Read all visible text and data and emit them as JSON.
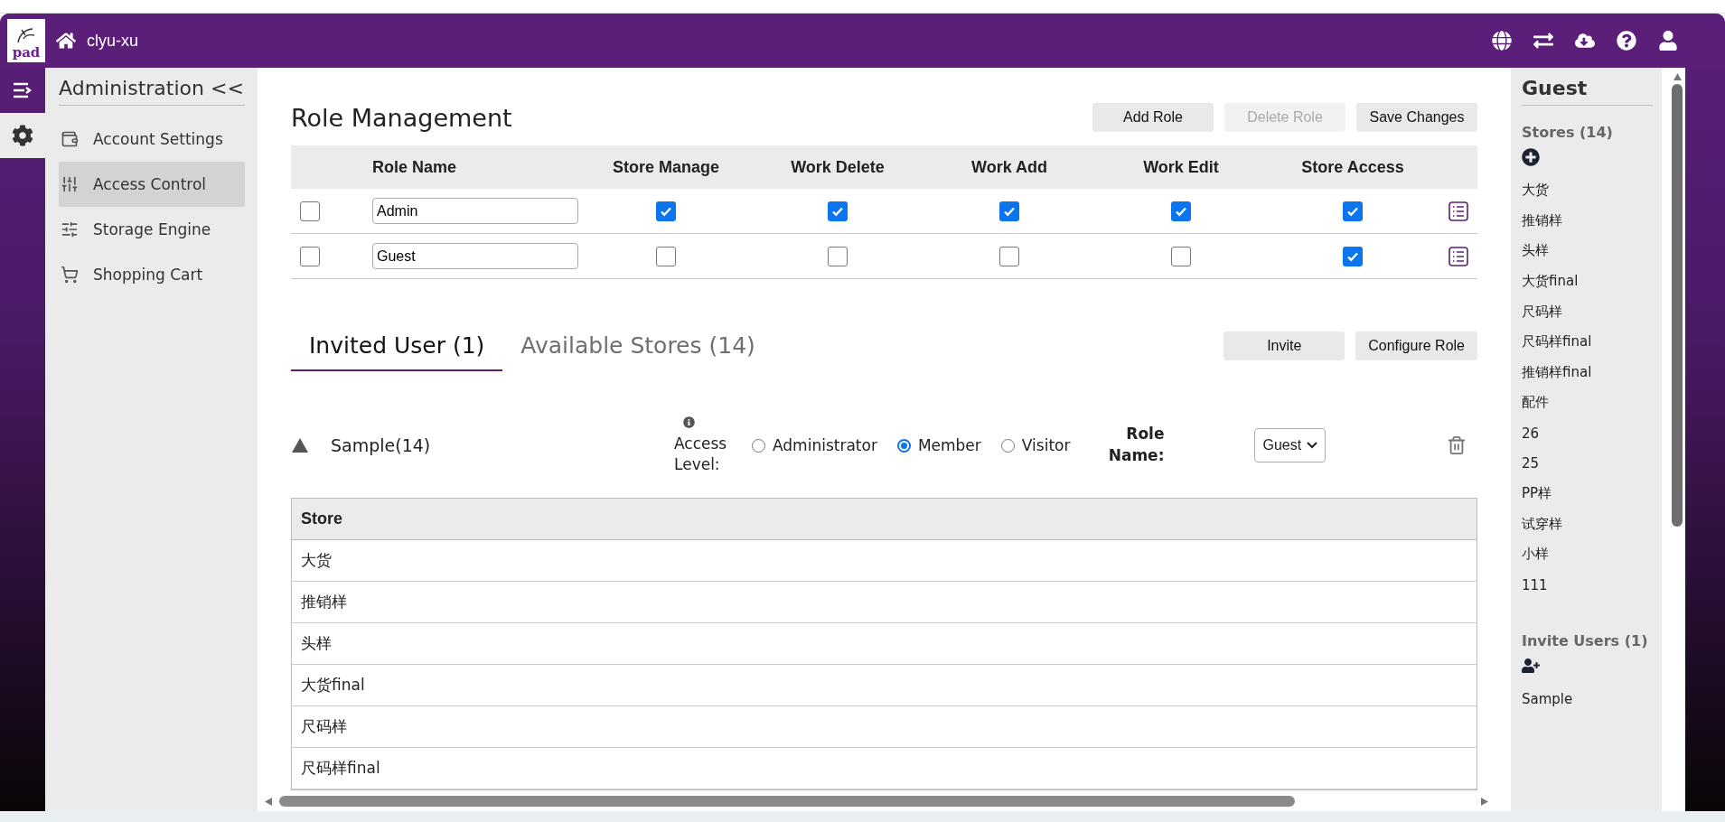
{
  "header": {
    "logo_text": "pad",
    "user": "clyu-xu",
    "actions": [
      {
        "kind": "globe"
      },
      {
        "kind": "switch"
      },
      {
        "kind": "cloud"
      },
      {
        "kind": "help"
      },
      {
        "kind": "user"
      }
    ]
  },
  "rail": [
    {
      "kind": "menu",
      "selected": false
    },
    {
      "kind": "settings",
      "selected": true
    }
  ],
  "sidebar": {
    "title": "Administration <<",
    "items": [
      {
        "label": "Account Settings",
        "kind": "wallet",
        "selected": false
      },
      {
        "label": "Access Control",
        "kind": "sliders",
        "selected": true
      },
      {
        "label": "Storage Engine",
        "kind": "tune",
        "selected": false
      },
      {
        "label": "Shopping Cart",
        "kind": "cart",
        "selected": false
      }
    ]
  },
  "role_management": {
    "title": "Role Management",
    "buttons": [
      {
        "label": "Add Role",
        "disabled": false
      },
      {
        "label": "Delete Role",
        "disabled": true
      },
      {
        "label": "Save Changes",
        "disabled": false
      }
    ],
    "columns": [
      "Role Name",
      "Store Manage",
      "Work Delete",
      "Work Add",
      "Work Edit",
      "Store Access"
    ],
    "rows": [
      {
        "checked": false,
        "name": "Admin",
        "permissions": [
          true,
          true,
          true,
          true,
          true
        ]
      },
      {
        "checked": false,
        "name": "Guest",
        "permissions": [
          false,
          false,
          false,
          false,
          true
        ]
      }
    ]
  },
  "tabs": [
    {
      "label": "Invited User (1)",
      "selected": true
    },
    {
      "label": "Available Stores (14)",
      "selected": false
    }
  ],
  "tab_buttons": [
    "Invite",
    "Configure Role"
  ],
  "member": {
    "name": "Sample(14)",
    "expanded": true,
    "access_label": "Access Level:",
    "options": [
      {
        "label": "Administrator",
        "selected": false
      },
      {
        "label": "Member",
        "selected": true
      },
      {
        "label": "Visitor",
        "selected": false
      }
    ],
    "role_label": "Role Name:",
    "role_value": "Guest"
  },
  "store_table": {
    "column": "Store",
    "rows": [
      "大货",
      "推销样",
      "头样",
      "大货final",
      "尺码样",
      "尺码样final"
    ]
  },
  "right_panel": {
    "title": "Guest",
    "stores_heading": "Stores (14)",
    "stores": [
      "大货",
      "推销样",
      "头样",
      "大货final",
      "尺码样",
      "尺码样final",
      "推销样final",
      "配件",
      "26",
      "25",
      "PP样",
      "试穿样",
      "小样",
      "111"
    ],
    "users_heading": "Invite Users (1)",
    "users": [
      "Sample"
    ]
  }
}
